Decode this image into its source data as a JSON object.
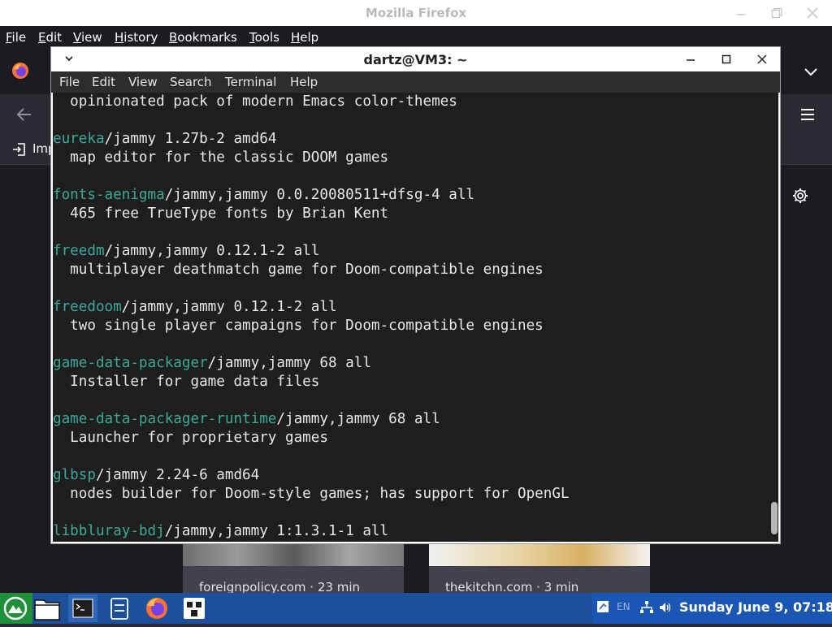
{
  "firefox": {
    "window_title": "Mozilla Firefox",
    "menu": [
      "File",
      "Edit",
      "View",
      "History",
      "Bookmarks",
      "Tools",
      "Help"
    ],
    "bookmarks_toolbar": {
      "import_label": "Imp"
    },
    "cards": [
      {
        "source": "foreignpolicy.com · 23 min"
      },
      {
        "source": "thekitchn.com · 3 min"
      }
    ]
  },
  "terminal": {
    "title": "dartz@VM3: ~",
    "menu": [
      "File",
      "Edit",
      "View",
      "Search",
      "Terminal",
      "Help"
    ],
    "lines": [
      {
        "pkg": "",
        "rest": "  opinionated pack of modern Emacs color-themes"
      },
      {
        "pkg": "",
        "rest": ""
      },
      {
        "pkg": "eureka",
        "rest": "/jammy 1.27b-2 amd64"
      },
      {
        "pkg": "",
        "rest": "  map editor for the classic DOOM games"
      },
      {
        "pkg": "",
        "rest": ""
      },
      {
        "pkg": "fonts-aenigma",
        "rest": "/jammy,jammy 0.0.20080511+dfsg-4 all"
      },
      {
        "pkg": "",
        "rest": "  465 free TrueType fonts by Brian Kent"
      },
      {
        "pkg": "",
        "rest": ""
      },
      {
        "pkg": "freedm",
        "rest": "/jammy,jammy 0.12.1-2 all"
      },
      {
        "pkg": "",
        "rest": "  multiplayer deathmatch game for Doom-compatible engines"
      },
      {
        "pkg": "",
        "rest": ""
      },
      {
        "pkg": "freedoom",
        "rest": "/jammy,jammy 0.12.1-2 all"
      },
      {
        "pkg": "",
        "rest": "  two single player campaigns for Doom-compatible engines"
      },
      {
        "pkg": "",
        "rest": ""
      },
      {
        "pkg": "game-data-packager",
        "rest": "/jammy,jammy 68 all"
      },
      {
        "pkg": "",
        "rest": "  Installer for game data files"
      },
      {
        "pkg": "",
        "rest": ""
      },
      {
        "pkg": "game-data-packager-runtime",
        "rest": "/jammy,jammy 68 all"
      },
      {
        "pkg": "",
        "rest": "  Launcher for proprietary games"
      },
      {
        "pkg": "",
        "rest": ""
      },
      {
        "pkg": "glbsp",
        "rest": "/jammy 2.24-6 amd64"
      },
      {
        "pkg": "",
        "rest": "  nodes builder for Doom-style games; has support for OpenGL"
      },
      {
        "pkg": "",
        "rest": ""
      },
      {
        "pkg": "libbluray-bdj",
        "rest": "/jammy,jammy 1:1.3.1-1 all"
      }
    ]
  },
  "taskbar": {
    "keyboard_layout": "EN",
    "clock": "Sunday June  9, 07:18"
  },
  "colors": {
    "package_name": "#3aa89a",
    "terminal_bg": "#1e1e1e",
    "taskbar_bg": "#1e4f9a"
  }
}
